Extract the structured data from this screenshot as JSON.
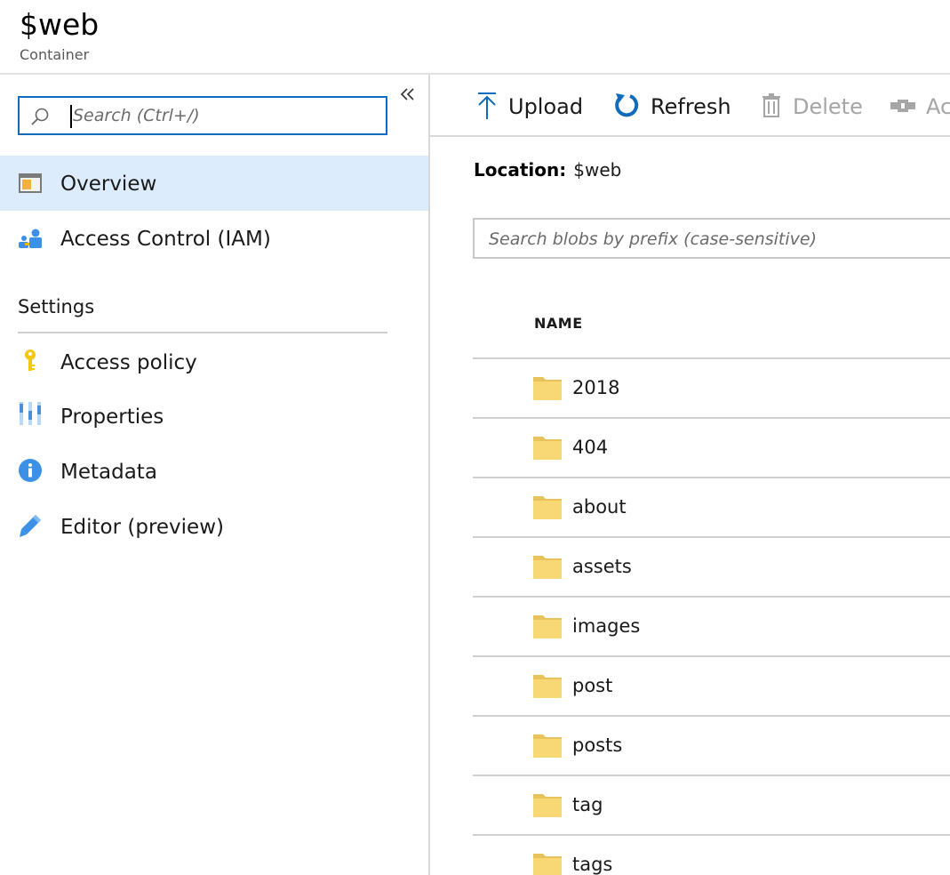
{
  "header": {
    "title": "$web",
    "subtitle": "Container"
  },
  "menu": {
    "search_placeholder": "Search (Ctrl+/)",
    "items": [
      {
        "label": "Overview",
        "icon": "overview-icon",
        "active": true
      },
      {
        "label": "Access Control (IAM)",
        "icon": "iam-icon",
        "active": false
      }
    ],
    "settings_heading": "Settings",
    "settings_items": [
      {
        "label": "Access policy",
        "icon": "key-icon"
      },
      {
        "label": "Properties",
        "icon": "properties-icon"
      },
      {
        "label": "Metadata",
        "icon": "info-icon"
      },
      {
        "label": "Editor (preview)",
        "icon": "pencil-icon"
      }
    ]
  },
  "toolbar": {
    "upload": "Upload",
    "refresh": "Refresh",
    "delete": "Delete",
    "access": "Ac"
  },
  "location": {
    "label": "Location:",
    "value": "$web"
  },
  "blob_search_placeholder": "Search blobs by prefix (case-sensitive)",
  "table": {
    "column_name": "NAME",
    "rows": [
      "2018",
      "404",
      "about",
      "assets",
      "images",
      "post",
      "posts",
      "tag",
      "tags"
    ]
  },
  "colors": {
    "accent": "#0f6cbd",
    "active_bg": "#dcecfc",
    "folder": "#f8d775"
  }
}
